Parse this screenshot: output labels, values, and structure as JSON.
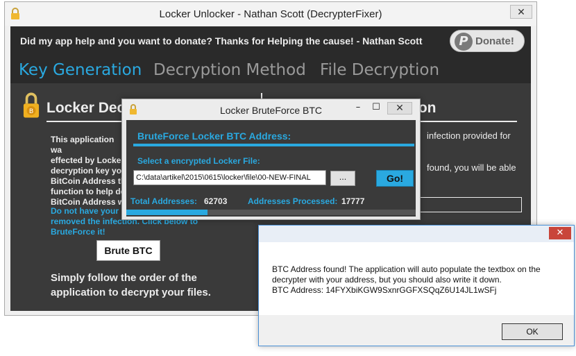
{
  "main_window": {
    "title": "Locker Unlocker - Nathan Scott (DecrypterFixer)",
    "close_glyph": "✕"
  },
  "donate_bar": {
    "message": "Did my app help and you want to donate? Thanks for Helping the cause! - Nathan Scott",
    "button_label": "Donate!",
    "button_icon": "paypal-icon",
    "button_icon_glyph": "P"
  },
  "tabs": [
    {
      "label": "Key Generation",
      "active": true
    },
    {
      "label": "Decryption Method",
      "active": false
    },
    {
      "label": "File Decryption",
      "active": false
    }
  ],
  "key_generation": {
    "section_title": "Locker Dec",
    "info_text": "This application wa\neffected by Locke\ndecryption key yo\nBitCoin Address th\nfunction to help de\nBitCoin Address w",
    "bruteforce_text": "Do not have your\nremoved the infection. Click below to\nBruteForce it!",
    "brute_button_label": "Brute BTC",
    "follow_text": "Simply follow the order of the\napplication to decrypt your files."
  },
  "right_section": {
    "section_title": "tion",
    "text_line1": "infection provided for",
    "text_line2": "found, you will be able",
    "address_input_value": ""
  },
  "bruteforce_window": {
    "title": "Locker BruteForce BTC",
    "min_glyph": "–",
    "max_glyph": "☐",
    "close_glyph": "✕",
    "heading": "BruteForce Locker BTC Address:",
    "select_label": "Select a encrypted Locker File:",
    "file_path": "C:\\data\\artikel\\2015\\0615\\locker\\file\\00-NEW-FINAL",
    "browse_label": "...",
    "go_label": "Go!",
    "total_label": "Total Addresses:",
    "total_value": "62703",
    "processed_label": "Addresses Processed:",
    "processed_value": "17777",
    "progress_fraction": 0.28
  },
  "message_box": {
    "close_glyph": "✕",
    "text": "BTC Address found! The application will auto populate the textbox on the\ndecrypter with your address, but you should also write it down.\nBTC Address: 14FYXbiKGW9SxnrGGFXSQqZ6U14JL1wSFj",
    "ok_label": "OK"
  },
  "colors": {
    "accent": "#2aa9e0",
    "dark_bg": "#3a3a3a",
    "bar_bg": "#2a2a2a",
    "text_light": "#ececec"
  }
}
